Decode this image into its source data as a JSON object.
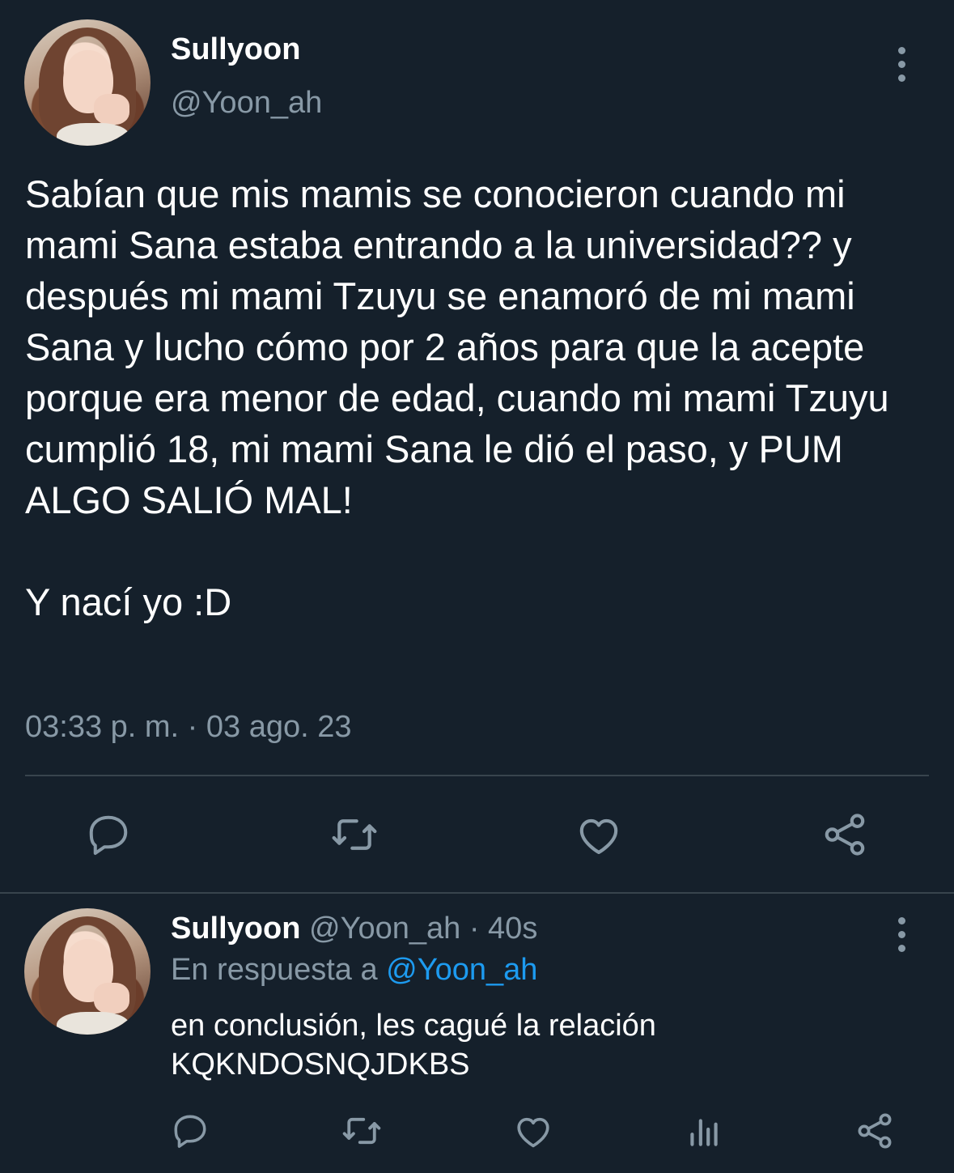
{
  "main_tweet": {
    "author_name": "Sullyoon",
    "author_handle": "@Yoon_ah",
    "text": "Sabían que mis mamis se conocieron cuando mi mami Sana estaba entrando a la universidad?? y después mi mami Tzuyu se enamoró de mi mami Sana y lucho cómo por 2 años para que la acepte porque era menor de edad, cuando mi mami Tzuyu cumplió 18, mi mami Sana le dió el paso, y PUM ALGO SALIÓ MAL!\n\nY nací yo :D",
    "timestamp": "03:33 p. m. · 03 ago. 23",
    "actions": [
      "reply-icon",
      "retweet-icon",
      "like-icon",
      "share-icon"
    ]
  },
  "reply_tweet": {
    "author_name": "Sullyoon",
    "author_handle": "@Yoon_ah",
    "time_sep": "·",
    "age": "40s",
    "replying_to_label": "En respuesta a",
    "replying_to_handle": "@Yoon_ah",
    "text": "en conclusión, les cagué la relación\nKQKNDOSNQJDKBS",
    "actions": [
      "reply-icon",
      "retweet-icon",
      "like-icon",
      "analytics-icon",
      "share-icon"
    ]
  },
  "colors": {
    "background": "#15202b",
    "secondary_text": "#8899a6",
    "divider": "#38444d",
    "mention": "#1d9bf0"
  }
}
